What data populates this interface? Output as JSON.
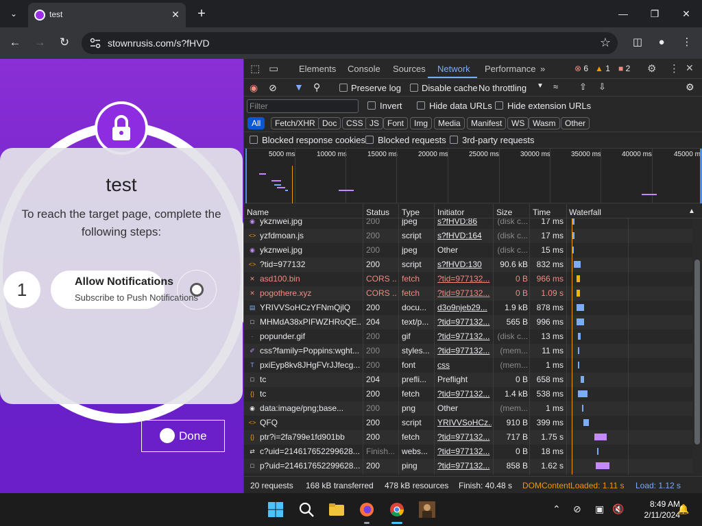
{
  "browser": {
    "tab_title": "test",
    "url": "stownrusis.com/s?fHVD"
  },
  "page": {
    "heading": "test",
    "instruction": "To reach the target page, complete the following steps:",
    "step_number": "1",
    "allow_title": "Allow Notifications",
    "allow_sub": "Subscribe to Push Notifications",
    "done_label": "Done"
  },
  "devtools": {
    "tabs": [
      "Elements",
      "Console",
      "Sources",
      "Network",
      "Performance"
    ],
    "errors": "6",
    "warnings": "1",
    "issues": "2",
    "preserve_log": "Preserve log",
    "disable_cache": "Disable cache",
    "throttling": "No throttling",
    "filter_placeholder": "Filter",
    "invert": "Invert",
    "hide_data": "Hide data URLs",
    "hide_ext": "Hide extension URLs",
    "type_filters": [
      "All",
      "Fetch/XHR",
      "Doc",
      "CSS",
      "JS",
      "Font",
      "Img",
      "Media",
      "Manifest",
      "WS",
      "Wasm",
      "Other"
    ],
    "blocked_cookies": "Blocked response cookies",
    "blocked_requests": "Blocked requests",
    "third_party": "3rd-party requests",
    "overview_ticks": [
      "5000 ms",
      "10000 ms",
      "15000 ms",
      "20000 ms",
      "25000 ms",
      "30000 ms",
      "35000 ms",
      "40000 ms",
      "45000 m"
    ],
    "columns": [
      "Name",
      "Status",
      "Type",
      "Initiator",
      "Size",
      "Time",
      "Waterfall"
    ],
    "rows": [
      {
        "name": "ykznwei.jpg",
        "status": "200",
        "type": "jpeg",
        "initiator": "s?fHVD:86",
        "size": "(disk c...",
        "time": "17 ms"
      },
      {
        "name": "yzfdmoan.js",
        "status": "200",
        "type": "script",
        "initiator": "s?fHVD:164",
        "size": "(disk c...",
        "time": "17 ms"
      },
      {
        "name": "ykznwei.jpg",
        "status": "200",
        "type": "jpeg",
        "initiator": "Other",
        "size": "(disk c...",
        "time": "15 ms"
      },
      {
        "name": "?tid=977132",
        "status": "200",
        "type": "script",
        "initiator": "s?fHVD:130",
        "size": "90.6 kB",
        "time": "832 ms"
      },
      {
        "name": "asd100.bin",
        "status": "CORS ...",
        "type": "fetch",
        "initiator": "?tid=977132...",
        "size": "0 B",
        "time": "966 ms"
      },
      {
        "name": "pogothere.xyz",
        "status": "CORS ...",
        "type": "fetch",
        "initiator": "?tid=977132...",
        "size": "0 B",
        "time": "1.09 s"
      },
      {
        "name": "YRIVVSoHCzYFNmQjlQ",
        "status": "200",
        "type": "docu...",
        "initiator": "d3o9njeb29...",
        "size": "1.9 kB",
        "time": "878 ms"
      },
      {
        "name": "MHMdA38xPIFWZHRoQE...",
        "status": "204",
        "type": "text/p...",
        "initiator": "?tid=977132...",
        "size": "565 B",
        "time": "996 ms"
      },
      {
        "name": "popunder.gif",
        "status": "200",
        "type": "gif",
        "initiator": "?tid=977132...",
        "size": "(disk c...",
        "time": "13 ms"
      },
      {
        "name": "css?family=Poppins:wght...",
        "status": "200",
        "type": "styles...",
        "initiator": "?tid=977132...",
        "size": "(mem...",
        "time": "11 ms"
      },
      {
        "name": "pxiEyp8kv8JHgFVrJJfecg...",
        "status": "200",
        "type": "font",
        "initiator": "css",
        "size": "(mem...",
        "time": "1 ms"
      },
      {
        "name": "tc",
        "status": "204",
        "type": "prefli...",
        "initiator": "Preflight",
        "size": "0 B",
        "time": "658 ms"
      },
      {
        "name": "tc",
        "status": "200",
        "type": "fetch",
        "initiator": "?tid=977132...",
        "size": "1.4 kB",
        "time": "538 ms"
      },
      {
        "name": "data:image/png;base...",
        "status": "200",
        "type": "png",
        "initiator": "Other",
        "size": "(mem...",
        "time": "1 ms"
      },
      {
        "name": "QFQ",
        "status": "200",
        "type": "script",
        "initiator": "YRIVVSoHCz...",
        "size": "910 B",
        "time": "399 ms"
      },
      {
        "name": "ptr?i=2fa799e1fd901bb",
        "status": "200",
        "type": "fetch",
        "initiator": "?tid=977132...",
        "size": "717 B",
        "time": "1.75 s"
      },
      {
        "name": "c?uid=214617652299628...",
        "status": "Finish...",
        "type": "webs...",
        "initiator": "?tid=977132...",
        "size": "0 B",
        "time": "18 ms"
      },
      {
        "name": "p?uid=214617652299628...",
        "status": "200",
        "type": "ping",
        "initiator": "?tid=977132...",
        "size": "858 B",
        "time": "1.62 s"
      }
    ],
    "status_bar": {
      "requests": "20 requests",
      "transferred": "168 kB transferred",
      "resources": "478 kB resources",
      "finish": "Finish: 40.48 s",
      "dcl": "DOMContentLoaded: 1.11 s",
      "load": "Load: 1.12 s"
    }
  },
  "taskbar": {
    "time": "8:49 AM",
    "date": "2/11/2024"
  },
  "colors": {
    "accent_purple": "#8b2fd6",
    "devtools_blue": "#7cacf8",
    "dcl_orange": "#f29900",
    "load_blue": "#4c8bf5",
    "error_red": "#f28b82"
  }
}
